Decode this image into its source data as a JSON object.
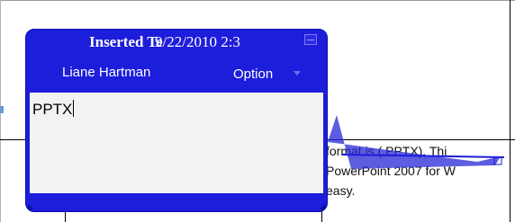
{
  "comment_balloon": {
    "title": "Inserted Te",
    "date": "9/22/2010 2:3",
    "author": "Liane Hartman",
    "options_label": "Option",
    "body_text": "PPTX"
  },
  "document": {
    "line1": "format is (.PPTX). Thi",
    "line2": "PowerPoint 2007 for W",
    "line3": "easy."
  },
  "colors": {
    "balloon_blue": "#1d1ddc",
    "body_gray": "#f2f2f2"
  },
  "icons": [
    "collapse-icon",
    "dropdown-arrow-icon"
  ]
}
